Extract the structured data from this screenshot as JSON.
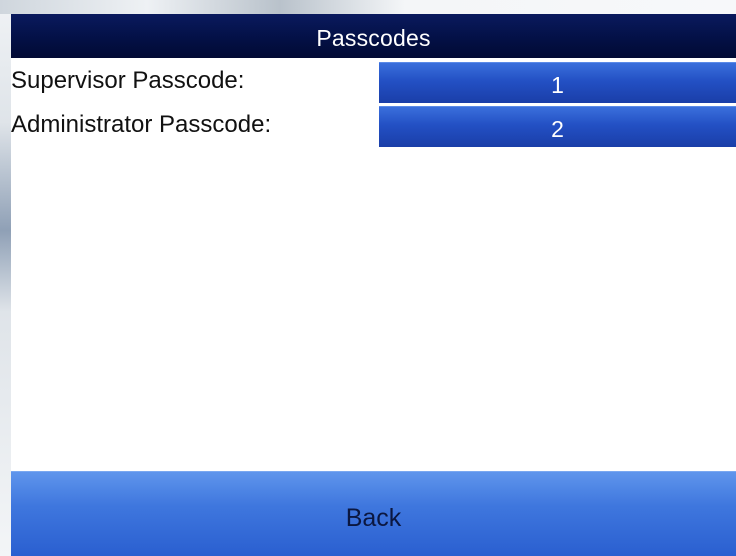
{
  "screen": {
    "title": "Passcodes"
  },
  "passcodes": [
    {
      "label": "Supervisor Passcode:",
      "value": "1"
    },
    {
      "label": "Administrator Passcode:",
      "value": "2"
    }
  ],
  "footer": {
    "back_label": "Back"
  },
  "colors": {
    "title_bar": "#031046",
    "value_field": "#2350c4",
    "back_button": "#3f77de"
  }
}
